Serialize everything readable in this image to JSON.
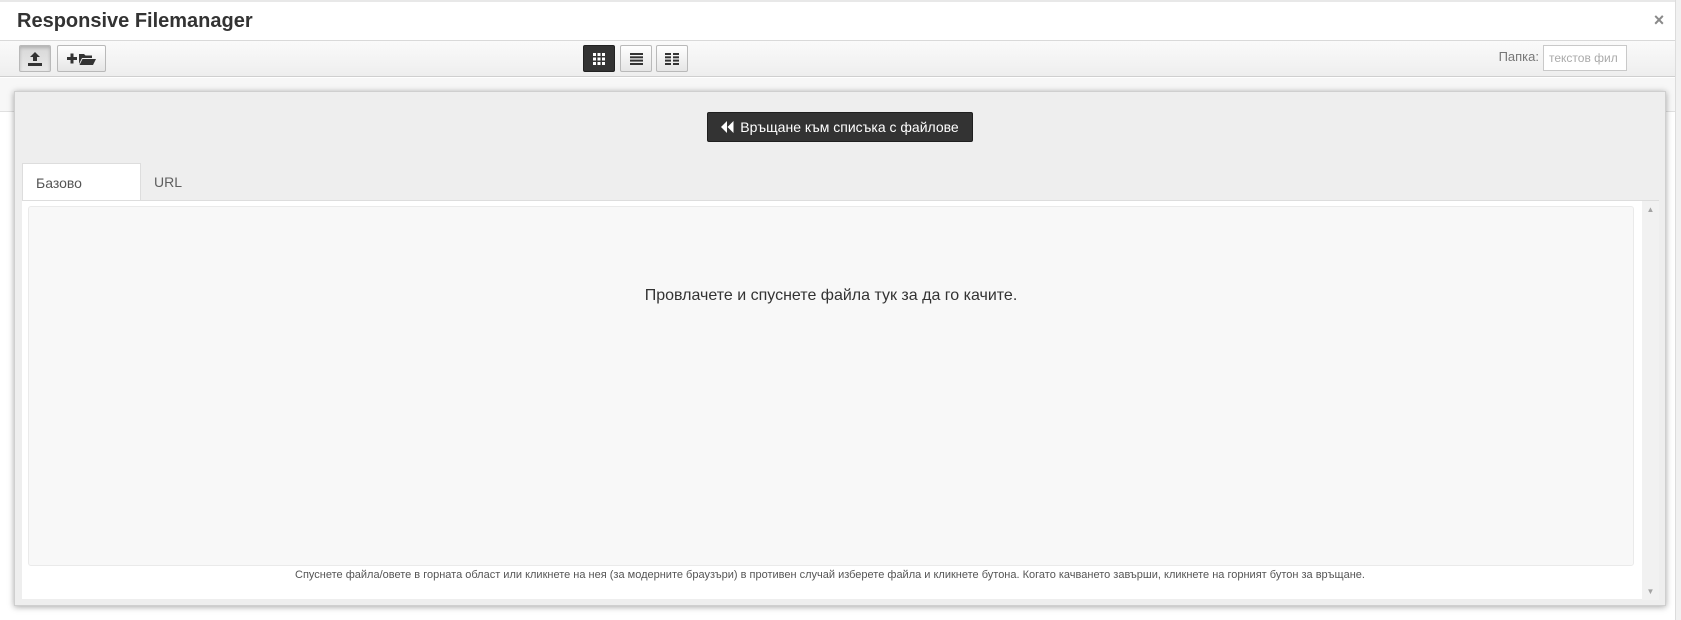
{
  "dialog": {
    "title": "Responsive Filemanager",
    "close_symbol": "×"
  },
  "toolbar": {
    "buttons": [
      {
        "name": "upload",
        "icon": "upload-icon",
        "pressed": true
      },
      {
        "name": "new-folder",
        "icon": "plus-folder-open-icon",
        "pressed": false
      }
    ],
    "view_modes": [
      {
        "name": "grid",
        "icon": "grid-view-icon",
        "active": true
      },
      {
        "name": "list",
        "icon": "list-view-icon",
        "active": false
      },
      {
        "name": "columns",
        "icon": "columns-list-icon",
        "active": false
      }
    ],
    "folder_label": "Папка:",
    "folder_placeholder": "текстов фил"
  },
  "upload_panel": {
    "back_button_label": "Връщане към списъка с файлове",
    "tabs": [
      {
        "label": "Базово качване",
        "active": true
      },
      {
        "label": "URL",
        "active": false
      }
    ],
    "dropzone_message": "Провлачете и спуснете файла тук за да го качите.",
    "help_text": "Спуснете файла/овете в горната област или кликнете на нея (за модерните браузъри) в противен случай изберете файла и кликнете бутона. Когато качването завърши, кликнете на горният бутон за връщане."
  },
  "colors": {
    "dark_button": "#333333",
    "panel_bg": "#eeeeee",
    "dropzone_bg": "#f8f8f8"
  }
}
